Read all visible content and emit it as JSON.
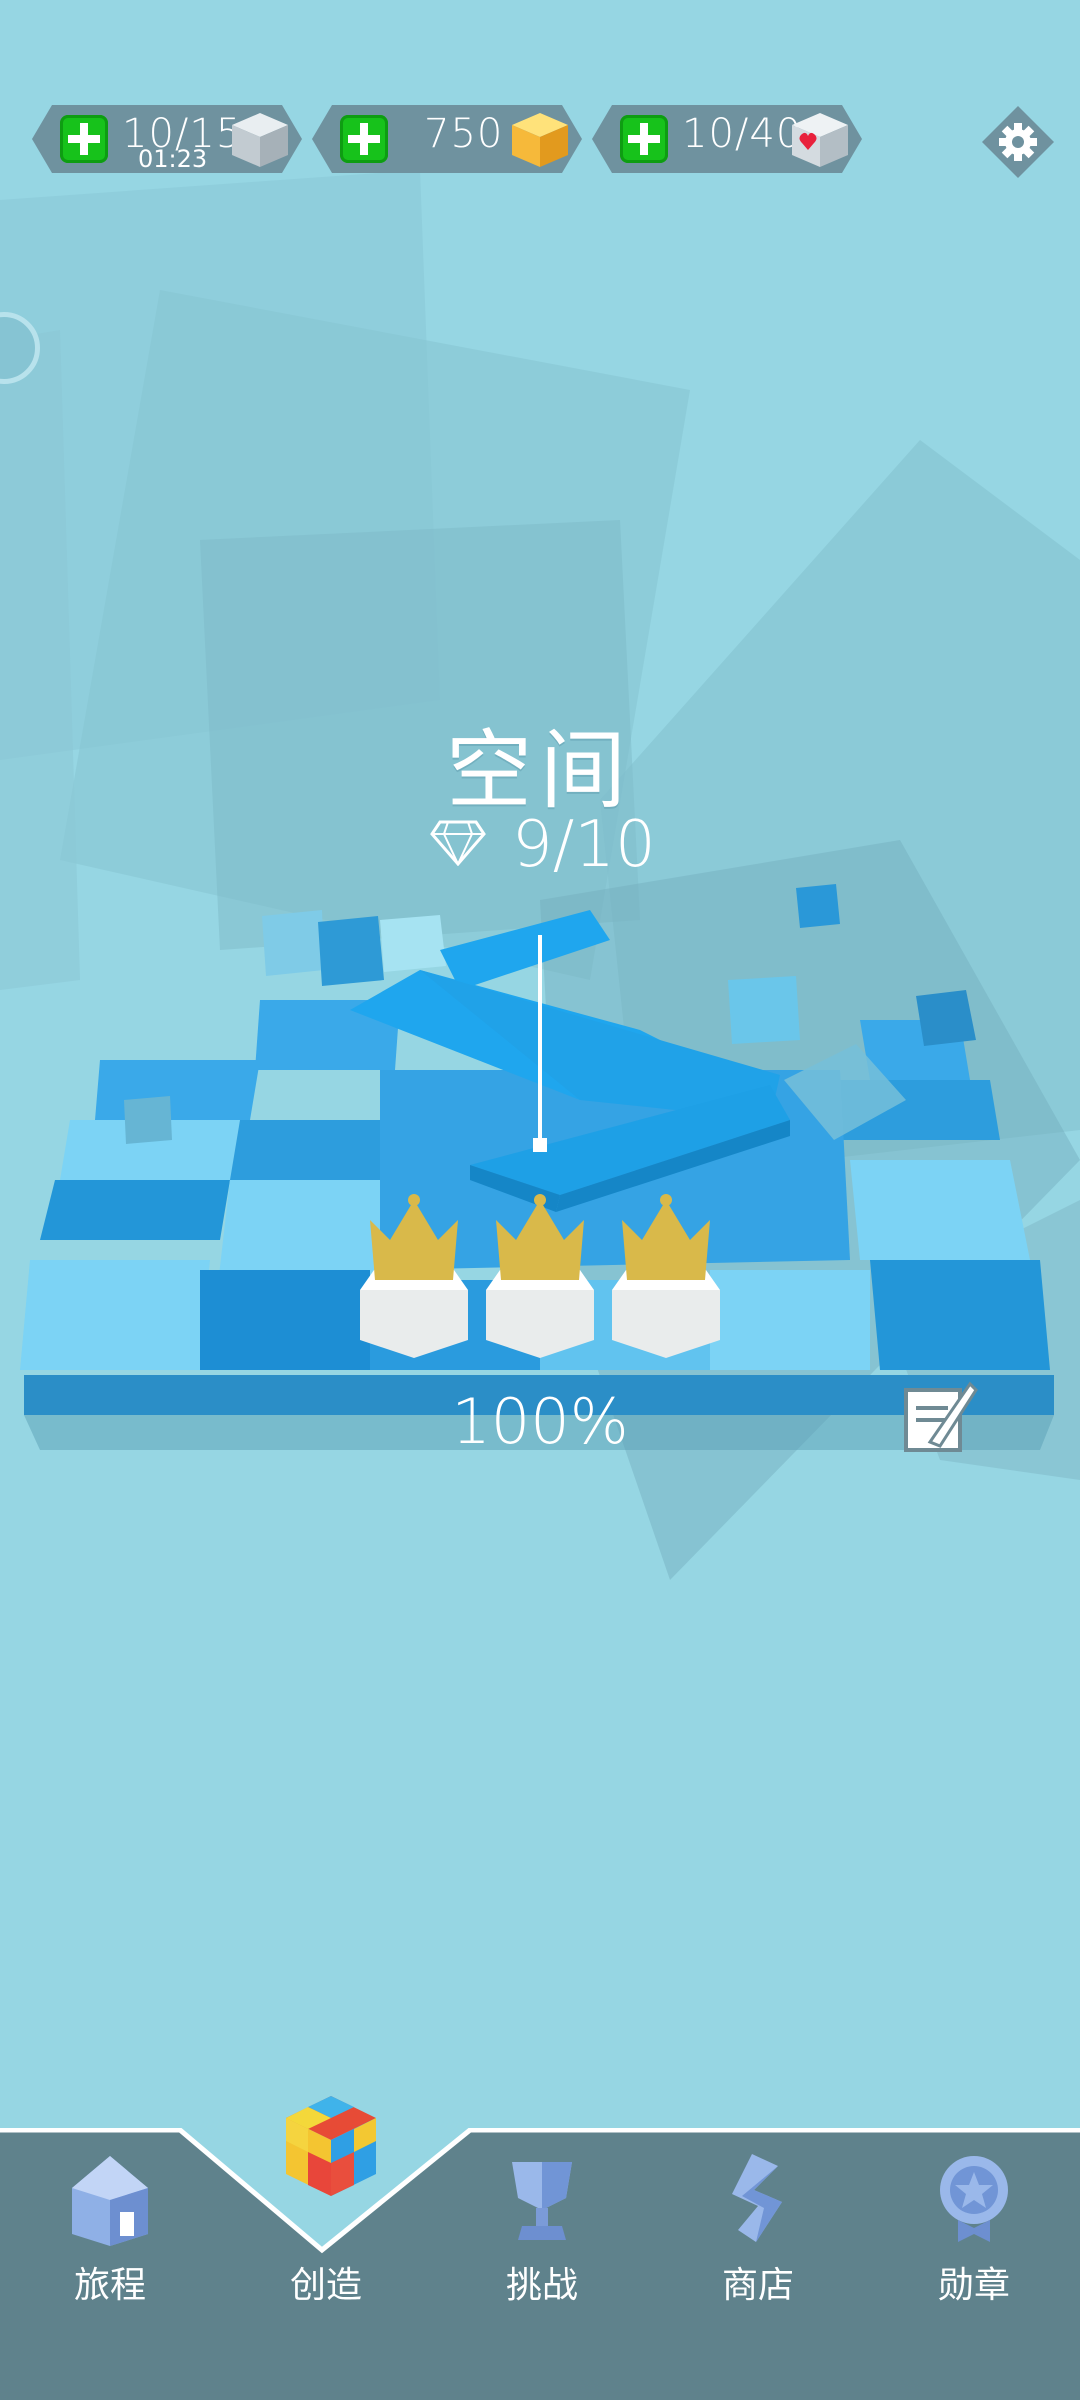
{
  "resources": {
    "lives": {
      "value": "10/15",
      "timer": "01:23",
      "icon": "gray-cube-icon"
    },
    "gems": {
      "value": "750",
      "icon": "gold-cube-icon"
    },
    "hearts": {
      "value": "10/40",
      "icon": "heart-cube-icon"
    }
  },
  "level": {
    "title": "空间",
    "diamonds": "9/10",
    "progress": "100%",
    "crowns": 3
  },
  "nav": {
    "items": [
      {
        "label": "旅程",
        "icon": "house-icon"
      },
      {
        "label": "创造",
        "icon": "rubik-cube-icon",
        "active": true
      },
      {
        "label": "挑战",
        "icon": "trophy-icon"
      },
      {
        "label": "商店",
        "icon": "shop-bolt-icon"
      },
      {
        "label": "勋章",
        "icon": "medal-icon"
      }
    ]
  },
  "colors": {
    "background": "#96d6e3",
    "nav_bg": "#5f828c",
    "accent_blue": "#1a9be0",
    "plus_green": "#17c21b",
    "gold": "#d9b94a"
  }
}
